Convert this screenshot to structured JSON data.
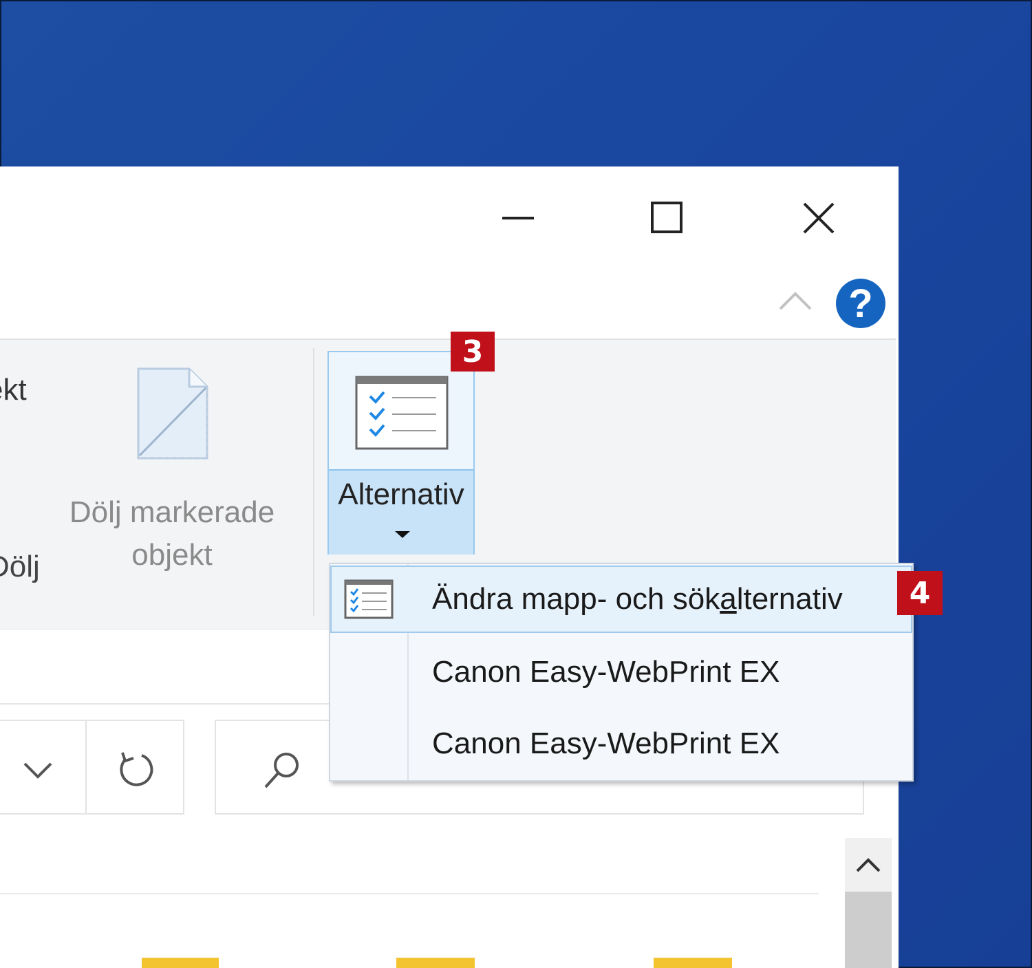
{
  "window": {
    "controls": {
      "minimize": "minimize",
      "maximize": "maximize",
      "close": "close"
    },
    "help": "?"
  },
  "ribbon": {
    "partial_top_text": "ekt",
    "partial_group_label": "Dölj",
    "hide_selected": {
      "line1": "Dölj markerade",
      "line2": "objekt"
    },
    "options_button": {
      "label": "Alternativ"
    }
  },
  "badges": {
    "step3": "3",
    "step4": "4"
  },
  "menu": {
    "items": [
      {
        "label_before": "Ändra mapp- och sök",
        "label_underlined": "a",
        "label_after": "lternativ",
        "icon": "options-checklist-icon",
        "hover": true
      },
      {
        "label": "Canon Easy-WebPrint EX"
      },
      {
        "label": "Canon Easy-WebPrint EX"
      }
    ]
  },
  "colors": {
    "desktop": "#1a47a0",
    "accent_blue": "#1565c0",
    "badge_red": "#c0101a",
    "selected_fill": "#c8e2f7"
  }
}
